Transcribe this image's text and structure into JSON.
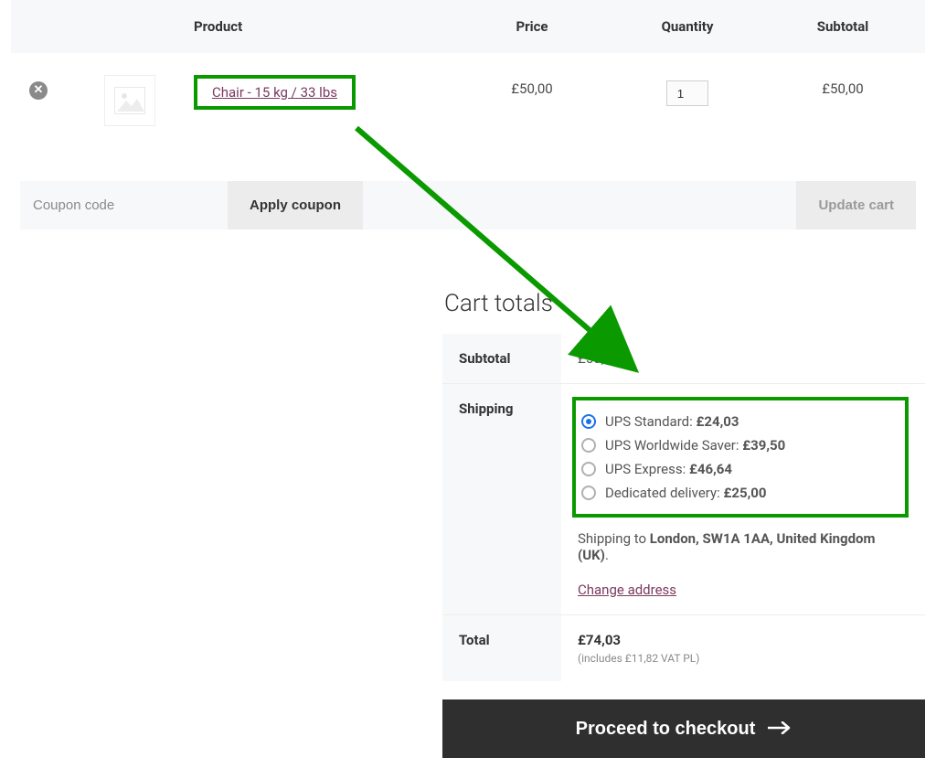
{
  "cart": {
    "headers": {
      "product": "Product",
      "price": "Price",
      "quantity": "Quantity",
      "subtotal": "Subtotal"
    },
    "item": {
      "name": "Chair - 15 kg / 33 lbs",
      "price": "£50,00",
      "quantity": "1",
      "subtotal": "£50,00"
    },
    "coupon_placeholder": "Coupon code",
    "apply_coupon": "Apply coupon",
    "update_cart": "Update cart"
  },
  "totals": {
    "title": "Cart totals",
    "labels": {
      "subtotal": "Subtotal",
      "shipping": "Shipping",
      "total": "Total"
    },
    "subtotal": "£50,00",
    "shipping_options": [
      {
        "label": "UPS Standard:",
        "price": "£24,03",
        "selected": true
      },
      {
        "label": "UPS Worldwide Saver:",
        "price": "£39,50",
        "selected": false
      },
      {
        "label": "UPS Express:",
        "price": "£46,64",
        "selected": false
      },
      {
        "label": "Dedicated delivery:",
        "price": "£25,00",
        "selected": false
      }
    ],
    "shipping_to_prefix": "Shipping to ",
    "shipping_to_address": "London, SW1A 1AA, United Kingdom (UK)",
    "shipping_to_suffix": ".",
    "change_address": "Change address",
    "total": "£74,03",
    "tax_note": "(includes £11,82 VAT PL)",
    "checkout": "Proceed to checkout"
  }
}
